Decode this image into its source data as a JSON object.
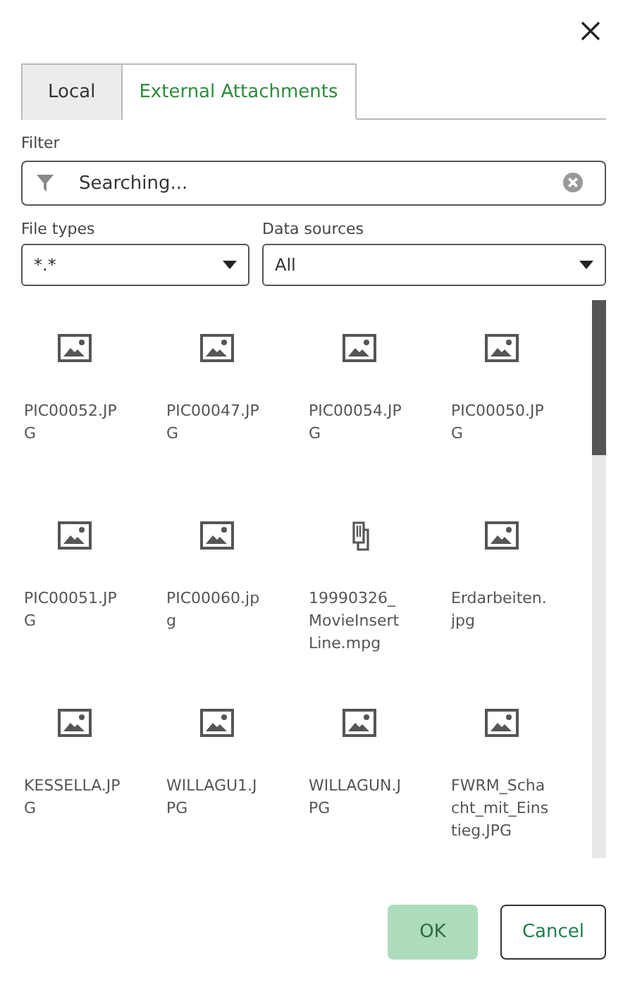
{
  "tabs": [
    {
      "label": "Local",
      "selected": false
    },
    {
      "label": "External Attachments",
      "selected": true
    }
  ],
  "filter": {
    "label": "Filter",
    "value": "Searching..."
  },
  "file_types": {
    "label": "File types",
    "value": "*.*"
  },
  "data_sources": {
    "label": "Data sources",
    "value": "All"
  },
  "files": [
    {
      "name": "PIC00052.JPG",
      "kind": "image"
    },
    {
      "name": "PIC00047.JPG",
      "kind": "image"
    },
    {
      "name": "PIC00054.JPG",
      "kind": "image"
    },
    {
      "name": "PIC00050.JPG",
      "kind": "image"
    },
    {
      "name": "PIC00051.JPG",
      "kind": "image"
    },
    {
      "name": "PIC00060.jpg",
      "kind": "image"
    },
    {
      "name": "19990326_MovieInsertLine.mpg",
      "kind": "attachment"
    },
    {
      "name": "Erdarbeiten.jpg",
      "kind": "image"
    },
    {
      "name": "KESSELLA.JPG",
      "kind": "image"
    },
    {
      "name": "WILLAGU1.JPG",
      "kind": "image"
    },
    {
      "name": "WILLAGUN.JPG",
      "kind": "image"
    },
    {
      "name": "FWRM_Schacht_mit_Einstieg.JPG",
      "kind": "image"
    }
  ],
  "buttons": [
    {
      "label": "OK",
      "kind": "primary",
      "disabled": true
    },
    {
      "label": "Cancel",
      "kind": "secondary",
      "disabled": false
    }
  ]
}
